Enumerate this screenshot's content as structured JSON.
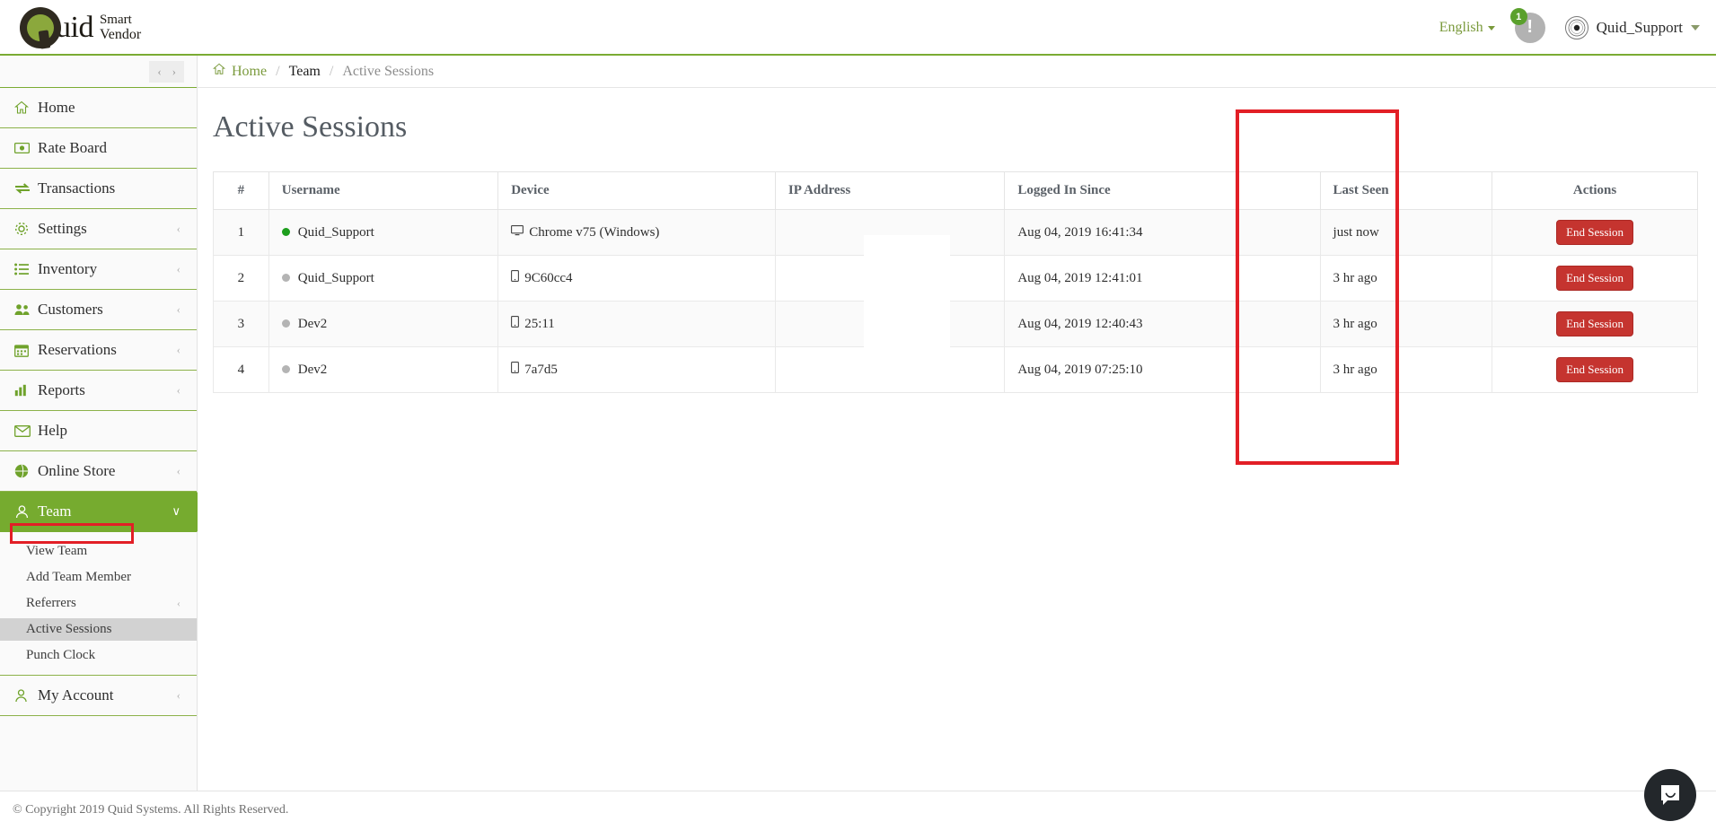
{
  "brand": {
    "name_main": "uid",
    "tagline_l1": "Smart",
    "tagline_l2": "Vendor",
    "logo_icon": "quid-q-logo",
    "accent_green": "#76ab2f",
    "danger_red": "#c5342f",
    "annotation_red": "#e21f26"
  },
  "topbar": {
    "language": "English",
    "language_caret_icon": "caret-down-icon",
    "notification_icon": "alert-exclamation-icon",
    "notification_count": "1",
    "avatar_icon": "user-avatar-seal",
    "username": "Quid_Support",
    "user_caret_icon": "chevron-down-icon"
  },
  "sidebar": {
    "collapse_prev_icon": "chevron-left-icon",
    "collapse_next_icon": "chevron-right-icon",
    "items": [
      {
        "label": "Home",
        "icon": "home-icon",
        "arrow": ""
      },
      {
        "label": "Rate Board",
        "icon": "money-bill-icon",
        "arrow": ""
      },
      {
        "label": "Transactions",
        "icon": "exchange-arrows-icon",
        "arrow": ""
      },
      {
        "label": "Settings",
        "icon": "gear-icon",
        "arrow": "‹"
      },
      {
        "label": "Inventory",
        "icon": "list-ul-icon",
        "arrow": "‹"
      },
      {
        "label": "Customers",
        "icon": "users-group-icon",
        "arrow": "‹"
      },
      {
        "label": "Reservations",
        "icon": "calendar-icon",
        "arrow": "‹"
      },
      {
        "label": "Reports",
        "icon": "bar-chart-icon",
        "arrow": "‹"
      },
      {
        "label": "Help",
        "icon": "envelope-icon",
        "arrow": ""
      },
      {
        "label": "Online Store",
        "icon": "globe-icon",
        "arrow": "‹"
      }
    ],
    "team": {
      "label": "Team",
      "icon": "team-user-icon",
      "arrow": "∨"
    },
    "team_subitems": [
      {
        "label": "View Team",
        "arrow": ""
      },
      {
        "label": "Add Team Member",
        "arrow": ""
      },
      {
        "label": "Referrers",
        "arrow": "‹"
      },
      {
        "label": "Active Sessions",
        "arrow": ""
      },
      {
        "label": "Punch Clock",
        "arrow": ""
      }
    ],
    "my_account": {
      "label": "My Account",
      "icon": "user-icon",
      "arrow": "‹"
    }
  },
  "breadcrumb": {
    "home_icon": "home-icon",
    "home": "Home",
    "separator": "/",
    "parent": "Team",
    "current": "Active Sessions"
  },
  "page": {
    "title": "Active Sessions"
  },
  "table": {
    "headers": {
      "num": "#",
      "username": "Username",
      "device": "Device",
      "ip": "IP Address",
      "since": "Logged In Since",
      "seen": "Last Seen",
      "actions": "Actions"
    },
    "rows": [
      {
        "num": "1",
        "status": "online",
        "username": "Quid_Support",
        "device_icon": "desktop-icon",
        "device": "Chrome v75 (Windows)",
        "ip": "",
        "since": "Aug 04, 2019 16:41:34",
        "seen": "just now",
        "action": "End Session"
      },
      {
        "num": "2",
        "status": "offline",
        "username": "Quid_Support",
        "device_icon": "mobile-icon",
        "device": "9C60cc4",
        "ip": "",
        "since": "Aug 04, 2019 12:41:01",
        "seen": "3 hr ago",
        "action": "End Session"
      },
      {
        "num": "3",
        "status": "offline",
        "username": "Dev2",
        "device_icon": "mobile-icon",
        "device": "25:11",
        "ip": "",
        "since": "Aug 04, 2019 12:40:43",
        "seen": "3 hr ago",
        "action": "End Session"
      },
      {
        "num": "4",
        "status": "offline",
        "username": "Dev2",
        "device_icon": "mobile-icon",
        "device": "7a7d5",
        "ip": "",
        "since": "Aug 04, 2019 07:25:10",
        "seen": "3 hr ago",
        "action": "End Session"
      }
    ]
  },
  "footer": {
    "copyright": "© Copyright 2019 Quid Systems. All Rights Reserved.",
    "chat_icon": "chat-bubble-smile-icon"
  }
}
